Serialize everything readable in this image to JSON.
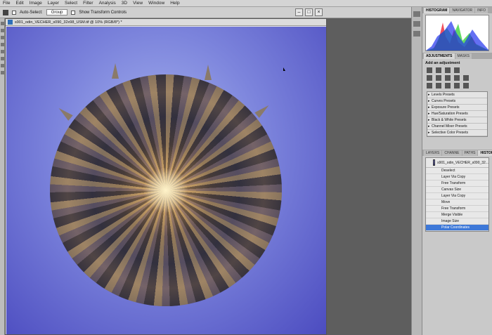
{
  "menu": [
    "File",
    "Edit",
    "Image",
    "Layer",
    "Select",
    "Filter",
    "Analysis",
    "3D",
    "View",
    "Window",
    "Help"
  ],
  "options_bar": {
    "auto_select_label": "Auto-Select:",
    "auto_select_value": "Group",
    "transform_label": "Show Transform Controls"
  },
  "document": {
    "title": "s901_odin_VECHER_s090_32x98_USM.tif @ 10% (RGB/8*) *"
  },
  "histogram_panel": {
    "tabs": [
      "HISTOGRAM",
      "NAVIGATOR",
      "INFO"
    ]
  },
  "adjustments_panel": {
    "tabs": [
      "ADJUSTMENTS",
      "MASKS"
    ],
    "title": "Add an adjustment",
    "presets": [
      "Levels Presets",
      "Curves Presets",
      "Exposure Presets",
      "Hue/Saturation Presets",
      "Black & White Presets",
      "Channel Mixer Presets",
      "Selective Color Presets"
    ]
  },
  "history_panel": {
    "tabs": [
      "LAYERS",
      "CHANNE",
      "PATHS",
      "HISTORY"
    ],
    "snapshot": "s901_odin_VECHER_s090_32...",
    "items": [
      "Deselect",
      "Layer Via Copy",
      "Free Transform",
      "Canvas Size",
      "Layer Via Copy",
      "Move",
      "Free Transform",
      "Merge Visible",
      "Image Size",
      "Polar Coordinates"
    ],
    "selected_index": 9
  },
  "colors": {
    "accent": "#3d78d8",
    "sky": "#5a5ad0"
  }
}
